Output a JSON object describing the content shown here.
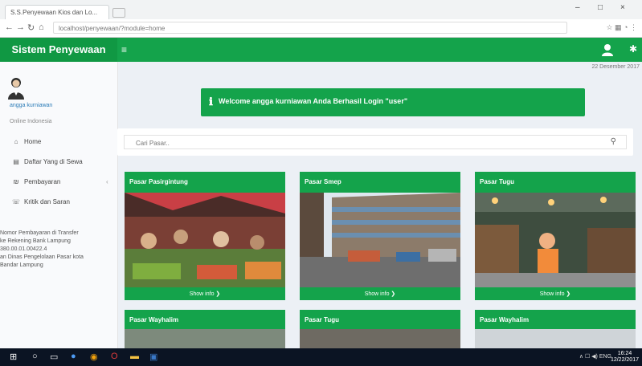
{
  "browser": {
    "tab_title": "S.S.Penyewaan Kios dan Lo...",
    "address": "localhost/penyewaan/?module=home",
    "window_controls": {
      "minimize": "–",
      "maximize": "□",
      "close": "×"
    }
  },
  "app": {
    "brand": "Sistem Penyewaan",
    "menu_toggle": "≡",
    "date": "22 Desember 2017"
  },
  "sidebar": {
    "user_name": "angga kurniawan",
    "user_status": "Online  Indonesia",
    "items": [
      {
        "icon": "home-icon",
        "glyph": "⌂",
        "label": "Home",
        "chevron": ""
      },
      {
        "icon": "document-icon",
        "glyph": "▤",
        "label": "Daftar Yang di Sewa",
        "chevron": ""
      },
      {
        "icon": "payment-icon",
        "glyph": "₪",
        "label": "Pembayaran",
        "chevron": "‹"
      },
      {
        "icon": "comment-icon",
        "glyph": "☏",
        "label": "Kritik dan Saran",
        "chevron": ""
      }
    ],
    "info": "Nomor Pembayaran di Transfer\nke Rekening Bank Lampung\n380.00.01.00422.4\nan Dinas Pengelolaan Pasar kota\nBandar Lampung"
  },
  "alert": {
    "icon": "info-icon",
    "text": "Welcome angga kurniawan   Anda Berhasil Login \"user\""
  },
  "search": {
    "placeholder": "Cari Pasar..",
    "icon": "search-icon"
  },
  "cards": [
    {
      "title": "Pasar Pasirgintung",
      "footer": "Show info ❯"
    },
    {
      "title": "Pasar Smep",
      "footer": "Show info ❯"
    },
    {
      "title": "Pasar Tugu",
      "footer": "Show info ❯"
    }
  ],
  "cards_bottom": [
    {
      "title": "Pasar Wayhalim"
    },
    {
      "title": "Pasar Tugu"
    },
    {
      "title": "Pasar Wayhalim"
    }
  ],
  "taskbar": {
    "tray": "∧  ☐  ◀)  ENG",
    "time": "16:24",
    "date": "12/22/2017"
  }
}
